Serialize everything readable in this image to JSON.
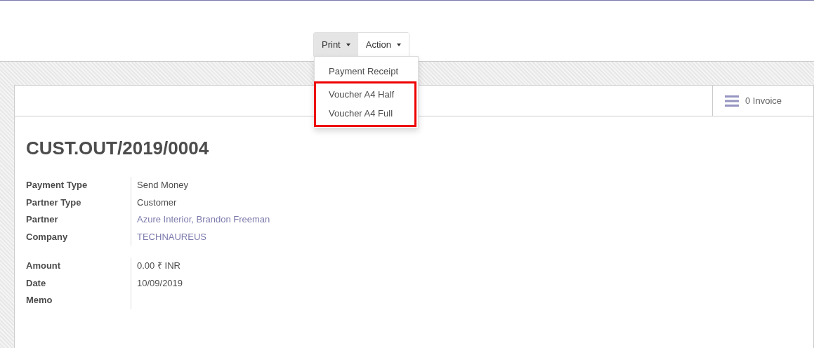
{
  "toolbar": {
    "buttons": [
      {
        "label": "Print",
        "selected": true
      },
      {
        "label": "Action",
        "selected": false
      }
    ]
  },
  "print_menu": {
    "items": [
      {
        "label": "Payment Receipt",
        "highlighted": false
      },
      {
        "label": "Voucher A4 Half",
        "highlighted": true
      },
      {
        "label": "Voucher A4 Full",
        "highlighted": true
      }
    ]
  },
  "smart_button": {
    "count": "0",
    "label": "Invoice"
  },
  "title": "CUST.OUT/2019/0004",
  "field_groups": [
    [
      {
        "label": "Payment Type",
        "value": "Send Money",
        "kind": "text"
      },
      {
        "label": "Partner Type",
        "value": "Customer",
        "kind": "text"
      },
      {
        "label": "Partner",
        "value": "Azure Interior, Brandon Freeman",
        "kind": "link"
      },
      {
        "label": "Company",
        "value": "TECHNAUREUS",
        "kind": "link"
      }
    ],
    [
      {
        "label": "Amount",
        "value": "0.00 ₹ INR",
        "kind": "text"
      },
      {
        "label": "Date",
        "value": "10/09/2019",
        "kind": "text"
      },
      {
        "label": "Memo"
      }
    ]
  ]
}
